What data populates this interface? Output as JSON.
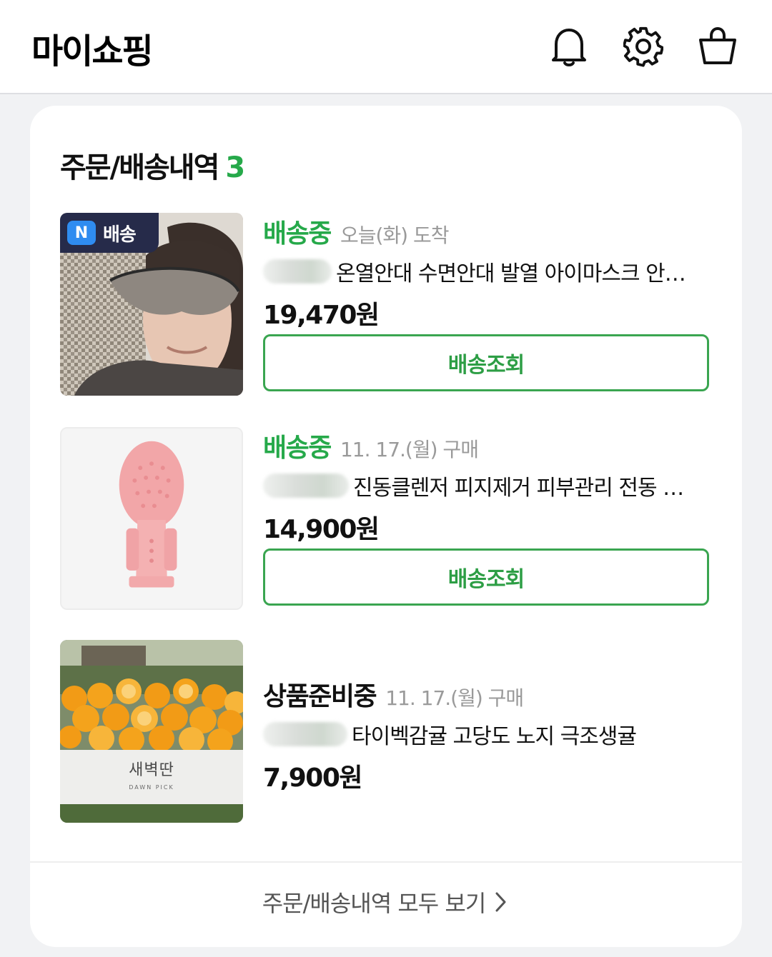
{
  "header": {
    "title": "마이쇼핑",
    "icons": [
      "bell-icon",
      "gear-icon",
      "shopping-basket-icon"
    ]
  },
  "orders_section": {
    "title": "주문/배송내역",
    "count": "3",
    "view_all": "주문/배송내역 모두 보기"
  },
  "orders": [
    {
      "status": "배송중",
      "meta": "오늘(화) 도착",
      "name": "온열안대 수면안대 발열 아이마스크 안…",
      "price": "19,470원",
      "button": "배송조회",
      "badge": {
        "logo": "N",
        "label": "배송"
      }
    },
    {
      "status": "배송중",
      "meta": "11. 17.(월) 구매",
      "name": "진동클렌저 피지제거 피부관리 전동 …",
      "price": "14,900원",
      "button": "배송조회"
    },
    {
      "status": "상품준비중",
      "meta": "11. 17.(월) 구매",
      "name": "타이벡감귤 고당도 노지 극조생귤",
      "price": "7,900원",
      "box_label": "새벽딴",
      "box_sublabel": "DAWN PICK"
    }
  ],
  "colors": {
    "accent_green": "#26a94a",
    "button_border": "#3aa550",
    "meta_gray": "#9a9a9a",
    "page_bg": "#f1f2f4"
  }
}
